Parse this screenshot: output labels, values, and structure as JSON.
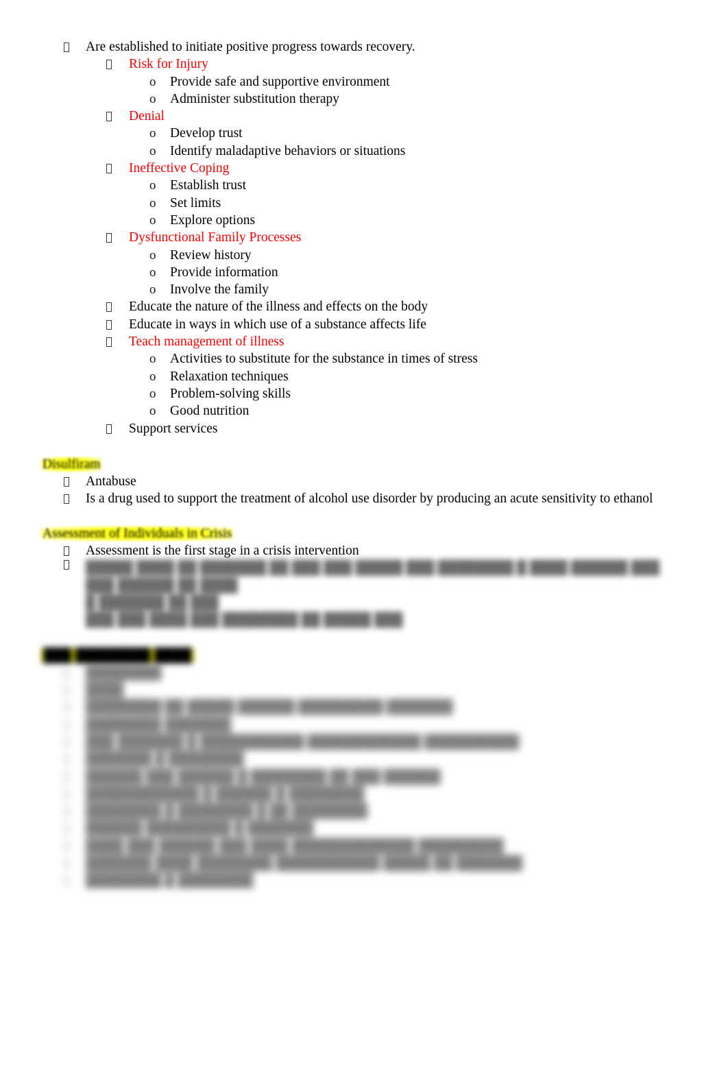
{
  "document": {
    "font_color_body": "#000000",
    "font_color_accent": "#ff0000",
    "highlight_color": "#ffff00",
    "bullet_glyph_level1": "tofu-box",
    "bullet_glyph_level2": "tofu-box",
    "bullet_glyph_level3": "o"
  },
  "outline": {
    "intro": {
      "marker": "",
      "text": "Are established to initiate positive progress towards recovery."
    },
    "diagnoses": [
      {
        "label": "Risk for Injury",
        "color": "#ff0000",
        "interventions": [
          "Provide safe and supportive environment",
          "Administer substitution therapy"
        ]
      },
      {
        "label": "Denial",
        "color": "#ff0000",
        "interventions": [
          "Develop trust",
          "Identify maladaptive behaviors or situations"
        ]
      },
      {
        "label": "Ineffective Coping",
        "color": "#ff0000",
        "interventions": [
          "Establish trust",
          "Set limits",
          "Explore options"
        ]
      },
      {
        "label": "Dysfunctional Family Processes",
        "color": "#ff0000",
        "interventions": [
          "Review history",
          "Provide information",
          "Involve the family"
        ]
      }
    ],
    "education": [
      {
        "label": "Educate the nature of the illness and effects on the body",
        "color": "#000000"
      },
      {
        "label": "Educate in ways in which use of a substance affects life",
        "color": "#000000"
      }
    ],
    "teach_management": {
      "label": "Teach management of illness",
      "color": "#ff0000",
      "items": [
        "Activities to substitute for the substance in times of stress",
        "Relaxation techniques",
        "Problem-solving skills",
        "Good nutrition"
      ]
    },
    "support": {
      "label": "Support services",
      "color": "#000000"
    }
  },
  "sections": [
    {
      "heading": "Disulfiram",
      "highlighted": true,
      "items": [
        "Antabuse",
        "Is a drug used to support the treatment of alcohol use disorder by producing an acute sensitivity to ethanol"
      ]
    },
    {
      "heading": "Assessment of Individuals in Crisis",
      "highlighted": true,
      "items": [
        "Assessment is the first stage in a crisis intervention"
      ]
    }
  ],
  "redacted": {
    "note": "blurred-content",
    "paragraph_lines": [
      "█████ ████ ██ ███████ ██ ███ ███ █████ ███ ████████ █ ████ ██████ ███",
      "███ ██████ ██ ████",
      "█ ███████ ██ ███",
      "███ ███ ████ ███ ████████ ██ █████ ███"
    ],
    "heading": "███ ████████ ████",
    "list_items": [
      "████████",
      "████",
      "████████ ██ █████ ██████ █████████ ███████",
      "████████ ███████",
      "███ ███████ █ ███████████ ████████████ ██████████",
      "███████ █ ████████",
      "██████ ███ ██████ █ ████████ ██ ███ ██████",
      "████████████ █ ██████ █ ████████",
      "████████ █ ████████ █ ██ ████████",
      "██████ █████████ █ ███████",
      "████ ███ ██████ ███ ████ █████████████ █████████",
      "███████ ████ ████████ ███████████ █████ ██ ███████",
      "████████ █ ████████"
    ]
  }
}
